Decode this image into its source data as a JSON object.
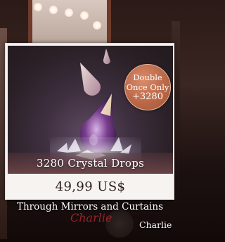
{
  "offer": {
    "title": "3280 Crystal Drops",
    "price": "49,99 US$",
    "badge": {
      "line1": "Double",
      "line2": "Once Only",
      "amount": "+3280"
    }
  },
  "caption": {
    "chapter_title": "Through Mirrors and Curtains",
    "signature": "Charlie",
    "author": "Charlie"
  },
  "colors": {
    "badge": "#b86645",
    "signature": "#b22633",
    "card_background": "#f6f3f1"
  }
}
